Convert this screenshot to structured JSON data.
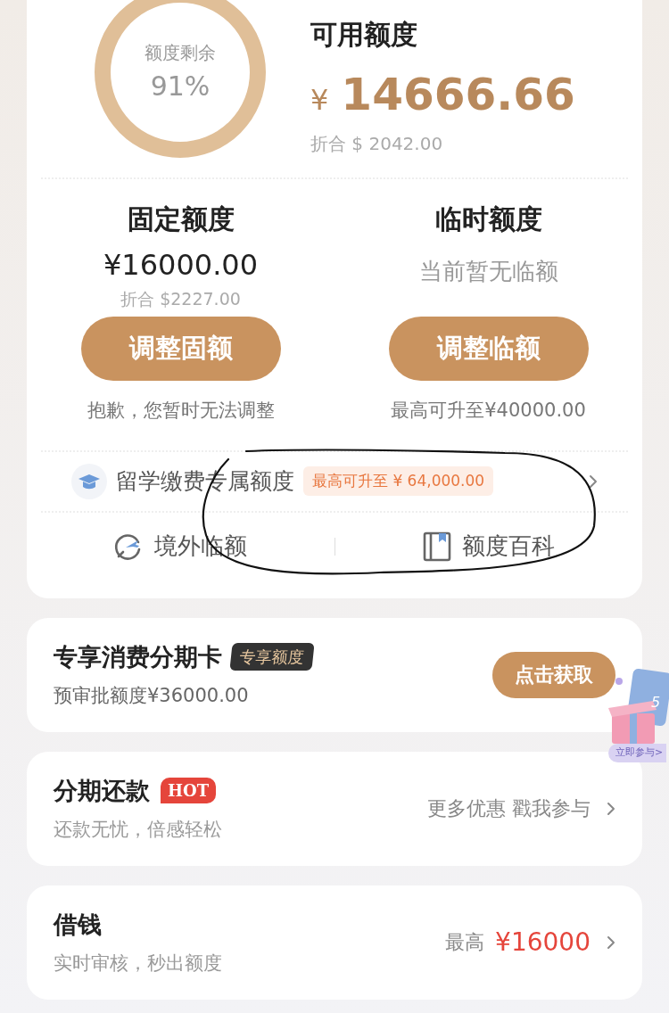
{
  "summary": {
    "ring_label": "额度剩余",
    "ring_percent": "91%",
    "title": "可用额度",
    "currency": "¥",
    "amount": "14666.66",
    "converted": "折合 $ 2042.00"
  },
  "limits": [
    {
      "title": "固定额度",
      "value": "¥16000.00",
      "sub": "折合 $2227.00",
      "button": "调整固额",
      "note": "抱歉，您暂时无法调整"
    },
    {
      "title": "临时额度",
      "value": "当前暂无临额",
      "button": "调整临额",
      "note": "最高可升至¥40000.00"
    }
  ],
  "study_row": {
    "label": "留学缴费专属额度",
    "badge": "最高可升至 ¥ 64,000.00"
  },
  "links": [
    {
      "kind": "plane",
      "label": "境外临额"
    },
    {
      "kind": "book",
      "label": "额度百科"
    }
  ],
  "installment_card": {
    "title": "专享消费分期卡",
    "tag": "专享额度",
    "sub": "预审批额度¥36000.00",
    "button": "点击获取"
  },
  "promo": {
    "discount": "5",
    "action": "立即参与>"
  },
  "services": [
    {
      "title": "分期还款",
      "tag": "HOT",
      "sub": "还款无忧，倍感轻松",
      "right_label": "更多优惠 戳我参与"
    },
    {
      "title": "借钱",
      "sub": "实时审核，秒出额度",
      "right_label": "最高",
      "right_value": "¥16000"
    }
  ]
}
